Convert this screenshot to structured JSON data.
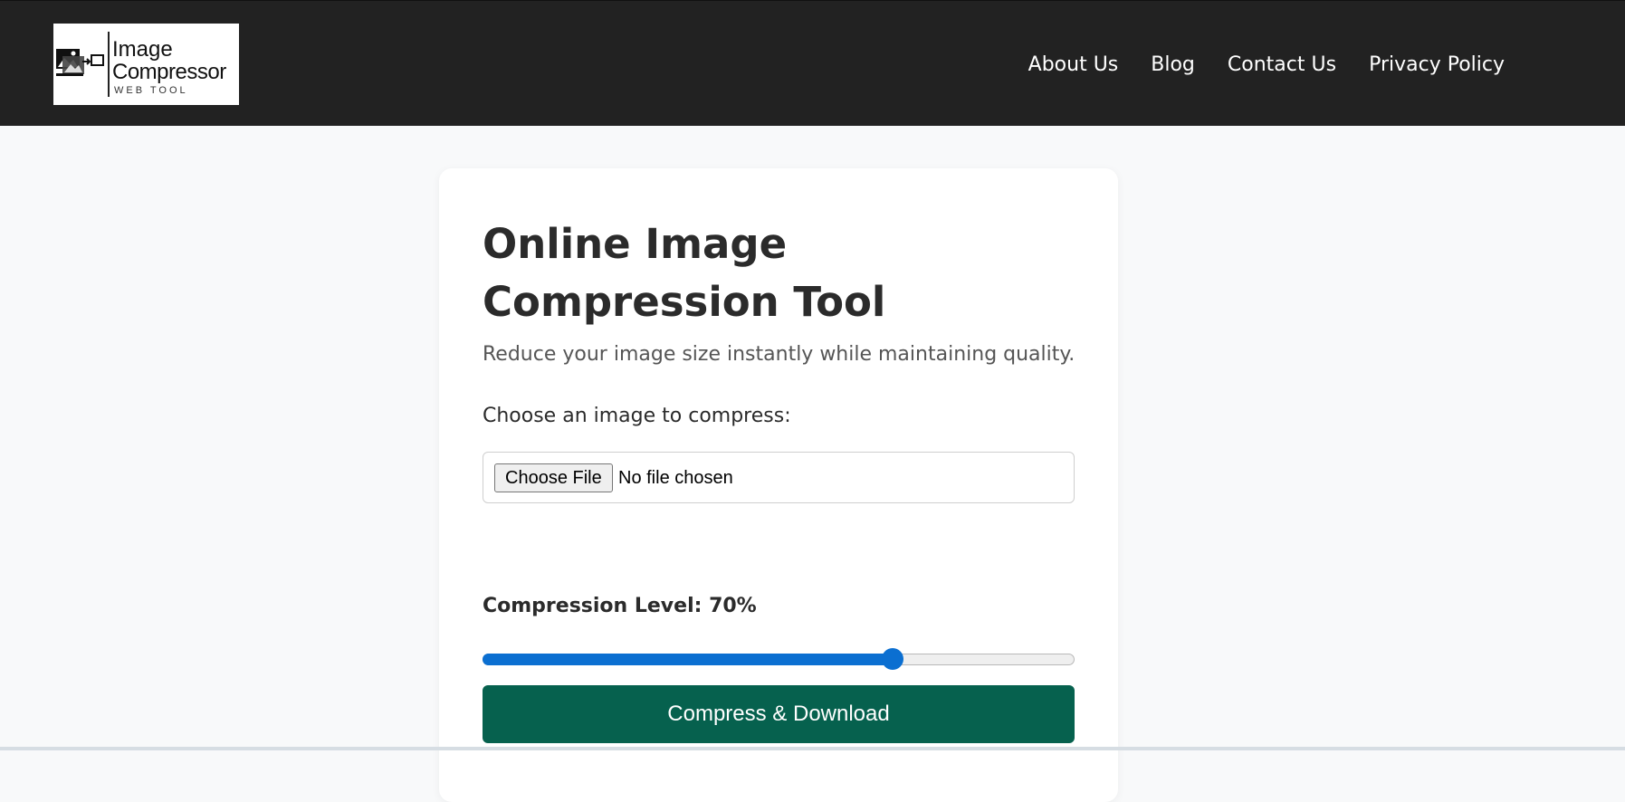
{
  "header": {
    "logo": {
      "line1": "Image",
      "line2": "Compressor",
      "line3": "WEB TOOL",
      "icon": "image-compress-icon"
    },
    "nav": [
      {
        "label": "About Us"
      },
      {
        "label": "Blog"
      },
      {
        "label": "Contact Us"
      },
      {
        "label": "Privacy Policy"
      }
    ]
  },
  "main": {
    "title": "Online Image Compression Tool",
    "subtitle": "Reduce your image size instantly while maintaining quality.",
    "file_label": "Choose an image to compress:",
    "file_button": "Choose File",
    "file_status": "No file chosen",
    "compression_label": "Compression Level: 70%",
    "compression_value": 70,
    "compress_button": "Compress & Download"
  },
  "colors": {
    "header_bg": "#222222",
    "page_bg": "#f8f9fa",
    "accent": "#0b6fd1",
    "button_bg": "#06614e"
  }
}
